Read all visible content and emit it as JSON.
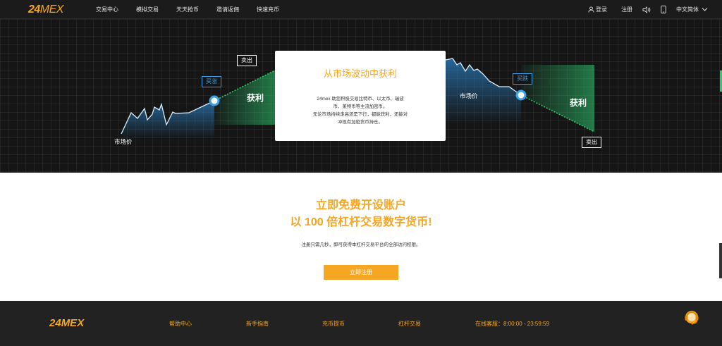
{
  "header": {
    "logo_num": "24",
    "logo_text": "MEX",
    "nav": [
      "交易中心",
      "模拟交易",
      "天天抢币",
      "邀请返佣",
      "快速充币"
    ],
    "login": "登录",
    "register": "注册",
    "language": "中文简体"
  },
  "hero": {
    "card_title": "从市场波动中获利",
    "card_lines": [
      "24mex 助您积极交易比特币、以太币、瑞波",
      "币、莱特币等主流加密币。",
      "无论市场持续走高还是下行，都能获利，还能对",
      "冲现有加密货币持仓。"
    ],
    "left_market": "市场价",
    "left_buy": "买涨",
    "left_sell": "卖出",
    "left_profit": "获利",
    "right_market": "市场价",
    "right_buy": "买跌",
    "right_sell": "卖出",
    "right_profit": "获利"
  },
  "cta": {
    "line1": "立即免费开设账户",
    "line2": "以 100 倍杠杆交易数字货币!",
    "sub": "注册只需几秒，即可获得本杠杆交易平台的全部访问权限。",
    "button": "立即注册"
  },
  "footer": {
    "logo_num": "24",
    "logo_text": "MEX",
    "links": [
      "帮助中心",
      "新手指南",
      "充币提币",
      "杠杆交易"
    ],
    "service": "在线客服：8:00:00 - 23:59:59"
  },
  "icons": {
    "login": "user-icon",
    "sound": "speaker-icon",
    "phone": "mobile-icon",
    "lang": "chevron-down-icon",
    "support": "headset-icon"
  },
  "colors": {
    "accent": "#f5a623",
    "buy_blue": "#3aa0e8",
    "profit_green": "#2ecc71",
    "dark": "#151515"
  }
}
